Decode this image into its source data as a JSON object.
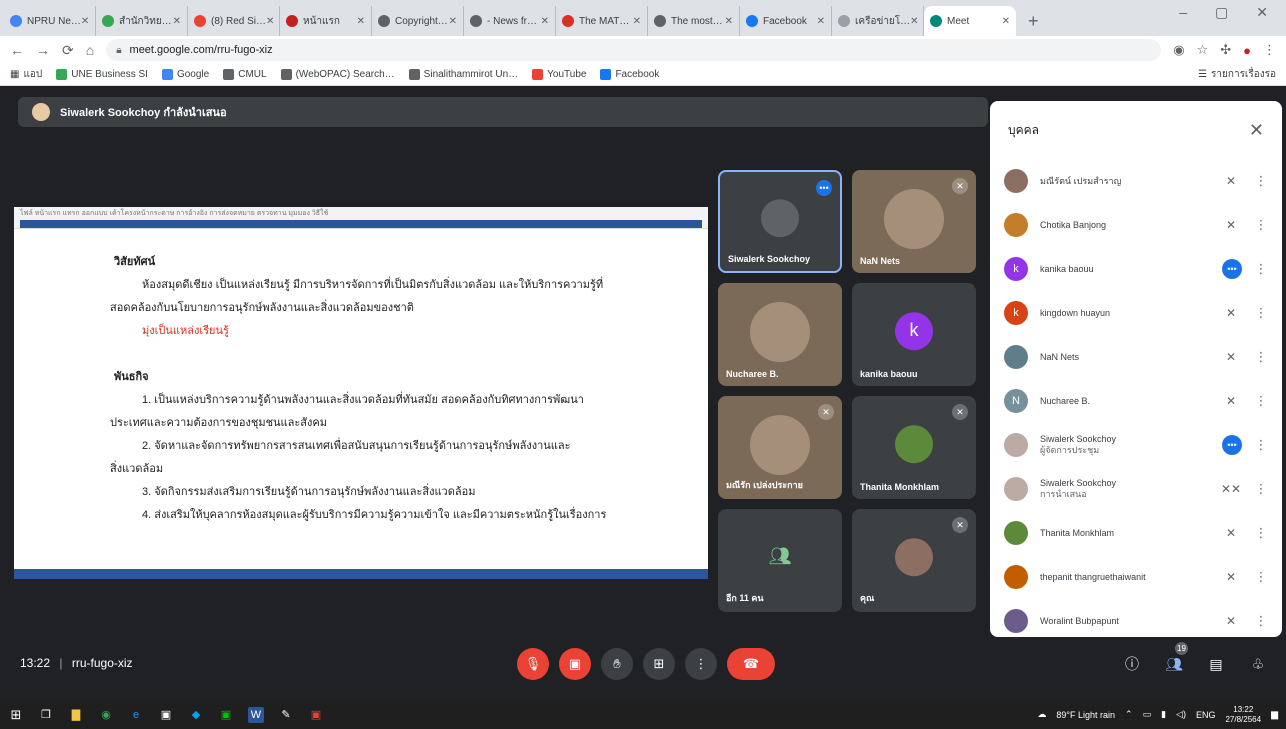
{
  "browser": {
    "tabs": [
      {
        "label": "NPRU Ne…",
        "color": "#4285f4"
      },
      {
        "label": "สำนักวิทย…",
        "color": "#34a853"
      },
      {
        "label": "(8) Red Si…",
        "color": "#ea4335"
      },
      {
        "label": "หน้าแรก",
        "color": "#c5221f"
      },
      {
        "label": "Copyright…",
        "color": "#5f6368"
      },
      {
        "label": "- News fr…",
        "color": "#5f6368"
      },
      {
        "label": "The MAT…",
        "color": "#d93025"
      },
      {
        "label": "The most…",
        "color": "#5f6368"
      },
      {
        "label": "Facebook",
        "color": "#1877f2"
      },
      {
        "label": "เครือข่ายโ…",
        "color": "#9aa0a6"
      },
      {
        "label": "Meet",
        "color": "#00897b",
        "active": true
      }
    ],
    "new_tab": "+",
    "url": "meet.google.com/rru-fugo-xiz",
    "bookmarks": [
      {
        "label": "UNE Business SI",
        "color": "#34a853"
      },
      {
        "label": "Google",
        "color": "#4285f4"
      },
      {
        "label": "CMUL",
        "color": "#5f6368"
      },
      {
        "label": "(WebOPAC) Search…",
        "color": "#5f6368"
      },
      {
        "label": "Sinalithammirot Un…",
        "color": "#5f6368"
      },
      {
        "label": "YouTube",
        "color": "#ea4335"
      },
      {
        "label": "Facebook",
        "color": "#1877f2"
      }
    ],
    "bookmark_apps": "แอป",
    "reading_list": "รายการเรื่องรอ"
  },
  "meet": {
    "presenter_banner": "Siwalerk Sookchoy กำลังนำเสนอ",
    "document": {
      "ribbon_text": "ไฟล์   หน้าแรก   แทรก   ออกแบบ   เค้าโครงหน้ากระดาษ   การอ้างอิง   การส่งจดหมาย   ตรวจทาน   มุมมอง   วิธีใช้",
      "lines": [
        {
          "text": "วิสัยทัศน์",
          "style": "h"
        },
        {
          "text": "ห้องสมุดดีเชียง เป็นแหล่งเรียนรู้ มีการบริหารจัดการที่เป็นมิตรกับสิ่งแวดล้อม และให้บริการความรู้ที่",
          "style": "ind"
        },
        {
          "text": "สอดคล้องกับนโยบายการอนุรักษ์พลังงานและสิ่งแวดล้อมของชาติ",
          "style": "neg"
        },
        {
          "text": "มุ่งเป็นแหล่งเรียนรู้",
          "style": "red"
        },
        {
          "text": "",
          "style": ""
        },
        {
          "text": "พันธกิจ",
          "style": "h"
        },
        {
          "text": "1. เป็นแหล่งบริการความรู้ด้านพลังงานและสิ่งแวดล้อมที่ทันสมัย สอดคล้องกับทิศทางการพัฒนา",
          "style": "ind"
        },
        {
          "text": "ประเทศและความต้องการของชุมชนและสังคม",
          "style": "neg"
        },
        {
          "text": "2. จัดหาและจัดการทรัพยากรสารสนเทศเพื่อสนับสนุนการเรียนรู้ด้านการอนุรักษ์พลังงานและ",
          "style": "ind"
        },
        {
          "text": "สิ่งแวดล้อม",
          "style": "neg"
        },
        {
          "text": "3. จัดกิจกรรมส่งเสริมการเรียนรู้ด้านการอนุรักษ์พลังงานและสิ่งแวดล้อม",
          "style": "ind"
        },
        {
          "text": "4. ส่งเสริมให้บุคลากรห้องสมุดและผู้รับบริการมีความรู้ความเข้าใจ และมีความตระหนักรู้ในเรื่องการ",
          "style": "ind"
        }
      ]
    },
    "tiles": [
      {
        "name": "Siwalerk Sookchoy",
        "initial": "",
        "color": "#5f6368",
        "mic": "•••",
        "mic_blue": true,
        "highlight": true
      },
      {
        "name": "NaN Nets",
        "initial": "",
        "color": "#a58f7b",
        "mic": "✕",
        "photo": true
      },
      {
        "name": "Nucharee B.",
        "initial": "",
        "color": "#a58f7b",
        "mic": "",
        "photo": true
      },
      {
        "name": "kanika baouu",
        "initial": "k",
        "color": "#9334e6",
        "mic": ""
      },
      {
        "name": "มณีรัก เปล่งประกาย",
        "initial": "",
        "color": "#a58f7b",
        "mic": "✕",
        "photo": true
      },
      {
        "name": "Thanita Monkhlam",
        "initial": "",
        "color": "#5d8a3a",
        "mic": "✕"
      },
      {
        "name": "อีก 11 คน",
        "initial": "",
        "color": "#5f6368",
        "mic": "",
        "others": true
      },
      {
        "name": "คุณ",
        "initial": "",
        "color": "#8d6e63",
        "mic": "✕"
      }
    ],
    "panel": {
      "title": "บุคคล",
      "close": "✕",
      "people": [
        {
          "name": "มณีรัตน์ เปรมสำราญ",
          "sub": "",
          "color": "#8d6e63",
          "initial": "",
          "mic": "✕"
        },
        {
          "name": "Chotika Banjong",
          "sub": "",
          "color": "#c47d2b",
          "initial": "",
          "mic": "✕"
        },
        {
          "name": "kanika baouu",
          "sub": "",
          "color": "#9334e6",
          "initial": "k",
          "mic": "•••",
          "mic_blue": true
        },
        {
          "name": "kingdown huayun",
          "sub": "",
          "color": "#d84315",
          "initial": "k",
          "mic": "✕"
        },
        {
          "name": "NaN Nets",
          "sub": "",
          "color": "#607d8b",
          "initial": "",
          "mic": "✕"
        },
        {
          "name": "Nucharee B.",
          "sub": "",
          "color": "#78909c",
          "initial": "N",
          "mic": "✕"
        },
        {
          "name": "Siwalerk Sookchoy",
          "sub": "ผู้จัดการประชุม",
          "color": "#bcaaa4",
          "initial": "",
          "mic": "•••",
          "mic_blue": true
        },
        {
          "name": "Siwalerk Sookchoy",
          "sub": "การนำเสนอ",
          "color": "#bcaaa4",
          "initial": "",
          "mic": "✕✕"
        },
        {
          "name": "Thanita Monkhlam",
          "sub": "",
          "color": "#5d8a3a",
          "initial": "",
          "mic": "✕"
        },
        {
          "name": "thepanit thangruethaiwanit",
          "sub": "",
          "color": "#c25e00",
          "initial": "",
          "mic": "✕"
        },
        {
          "name": "Woralint Bubpapunt",
          "sub": "",
          "color": "#6d5b8e",
          "initial": "",
          "mic": "✕"
        }
      ]
    },
    "controls": {
      "time": "13:22",
      "meeting_code": "rru-fugo-xiz",
      "people_count": "19"
    }
  },
  "taskbar": {
    "weather": "89°F Light rain",
    "lang": "ENG",
    "time": "13:22",
    "date": "27/8/2564"
  }
}
